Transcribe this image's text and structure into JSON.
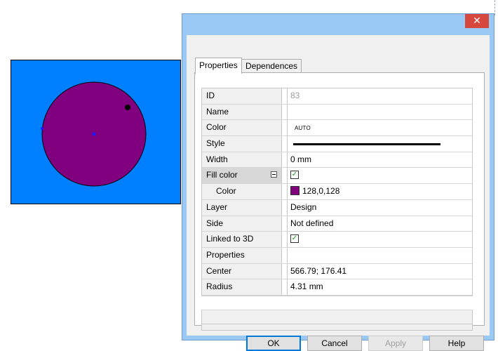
{
  "dialog": {
    "close_glyph": "✕"
  },
  "tabs": [
    {
      "label": "Properties",
      "active": true
    },
    {
      "label": "Dependences",
      "active": false
    }
  ],
  "properties": [
    {
      "key": "id",
      "label": "ID",
      "value": "83"
    },
    {
      "key": "name",
      "label": "Name",
      "value": ""
    },
    {
      "key": "color",
      "label": "Color",
      "value": "AUTO"
    },
    {
      "key": "style",
      "label": "Style",
      "value": ""
    },
    {
      "key": "width",
      "label": "Width",
      "value": "0 mm"
    },
    {
      "key": "fill_color",
      "label": "Fill color",
      "value": "",
      "checked": true
    },
    {
      "key": "fill_color_value",
      "label": "Color",
      "value": "128,0,128"
    },
    {
      "key": "layer",
      "label": "Layer",
      "value": "Design"
    },
    {
      "key": "side",
      "label": "Side",
      "value": "Not defined"
    },
    {
      "key": "linked_3d",
      "label": "Linked to 3D",
      "value": "",
      "checked": true
    },
    {
      "key": "properties",
      "label": "Properties",
      "value": ""
    },
    {
      "key": "center",
      "label": "Center",
      "value": "566.79; 176.41"
    },
    {
      "key": "radius",
      "label": "Radius",
      "value": "4.31 mm"
    }
  ],
  "buttons": {
    "ok": "OK",
    "cancel": "Cancel",
    "apply": "Apply",
    "help": "Help"
  },
  "colors": {
    "canvas_bg": "#0080ff",
    "circle_fill": "#800080",
    "fill_swatch": "#800080",
    "close_button": "#d6473e",
    "title_bar": "#99c9f4"
  },
  "icons": {
    "close": "close-icon",
    "collapse": "collapse-minus-icon",
    "checkbox": "checkmark-icon"
  }
}
